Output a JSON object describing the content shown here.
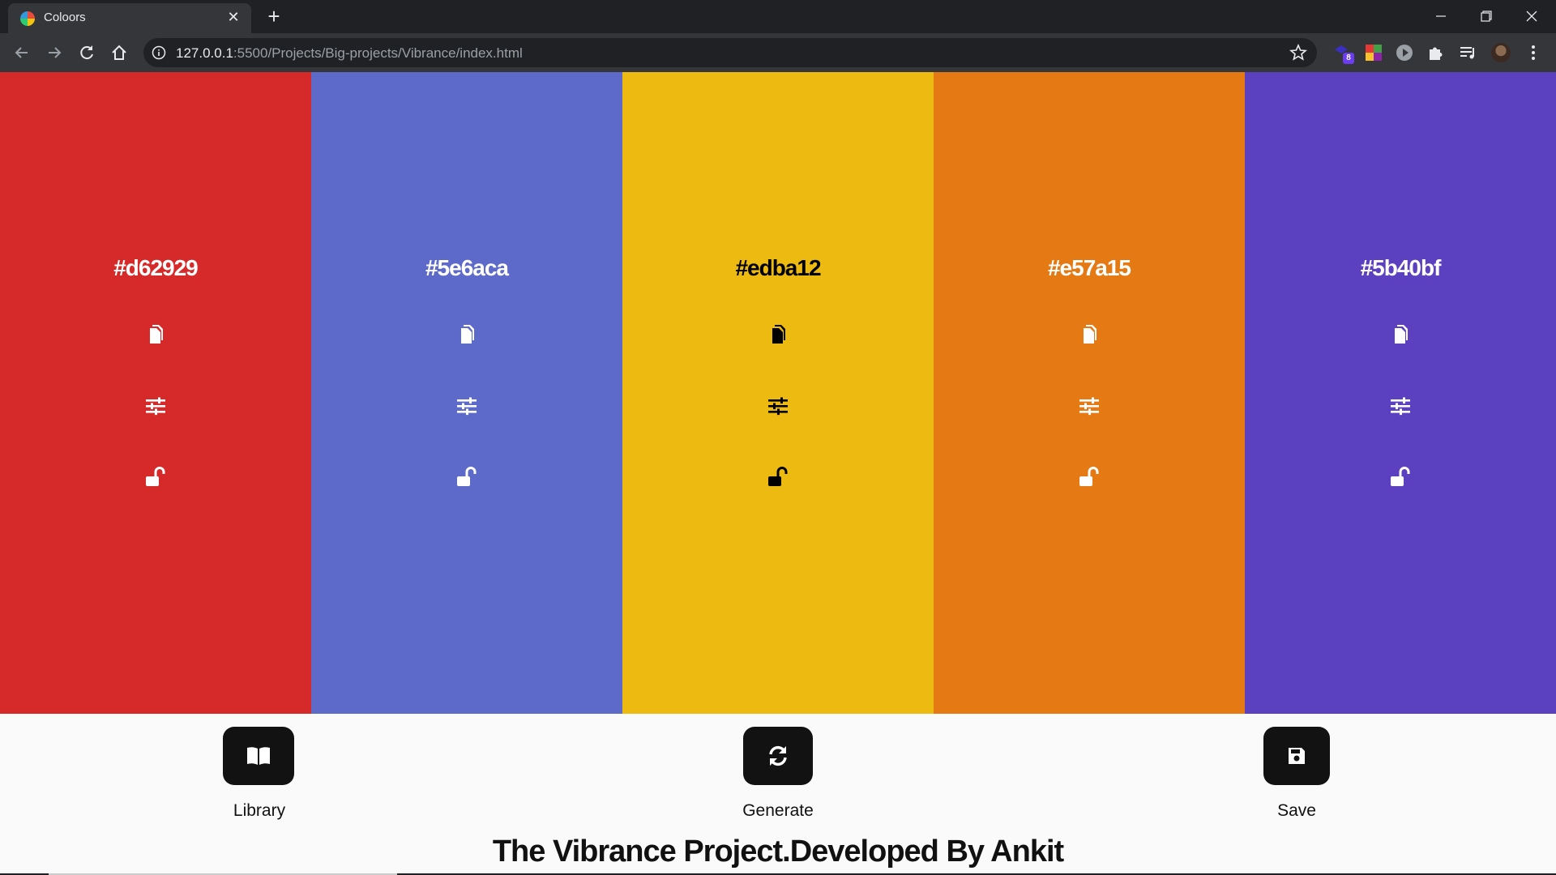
{
  "browser": {
    "tab_title": "Coloors",
    "url_host": "127.0.0.1",
    "url_rest": ":5500/Projects/Big-projects/Vibrance/index.html",
    "extension_badge": "8"
  },
  "swatches": [
    {
      "hex": "#d62929",
      "text_color": "#ffffff"
    },
    {
      "hex": "#5e6aca",
      "text_color": "#ffffff"
    },
    {
      "hex": "#edba12",
      "text_color": "#000000"
    },
    {
      "hex": "#e57a15",
      "text_color": "#ffffff"
    },
    {
      "hex": "#5b40bf",
      "text_color": "#ffffff"
    }
  ],
  "controls": {
    "library_label": "Library",
    "generate_label": "Generate",
    "save_label": "Save"
  },
  "footer": {
    "text": "The Vibrance Project.Developed By Ankit"
  },
  "icons": {
    "swatch_icons": [
      "copy-icon",
      "sliders-icon",
      "unlock-icon"
    ],
    "library": "book-icon",
    "generate": "refresh-icon",
    "save": "floppy-icon"
  }
}
